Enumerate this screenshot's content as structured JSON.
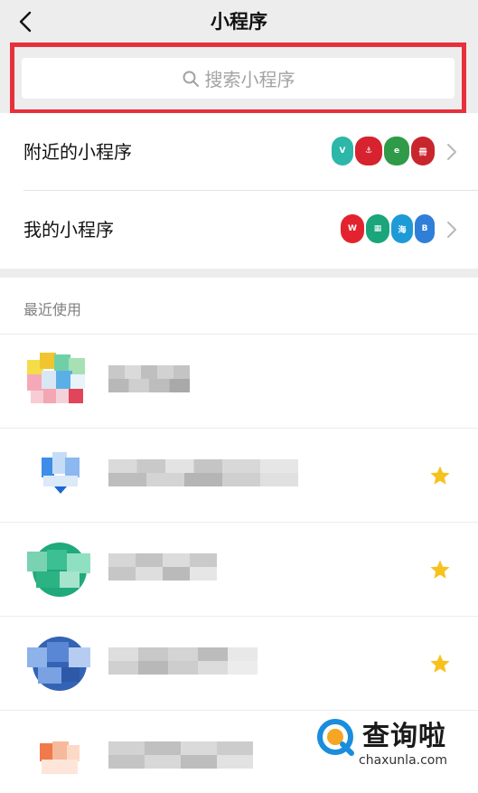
{
  "header": {
    "title": "小程序",
    "back_icon": "chevron-left-icon"
  },
  "search": {
    "placeholder": "搜索小程序",
    "icon": "search-icon",
    "highlight_color": "#e8303c"
  },
  "menu": {
    "nearby": {
      "label": "附近的小程序"
    },
    "mine": {
      "label": "我的小程序"
    }
  },
  "recent": {
    "section_label": "最近使用",
    "items": [
      {
        "starred": false
      },
      {
        "starred": true
      },
      {
        "starred": true
      },
      {
        "starred": true
      },
      {
        "starred": false
      }
    ]
  },
  "watermark": {
    "text": "查询啦",
    "url": "chaxunla.com"
  },
  "colors": {
    "star": "#f7c21e",
    "accent_blue": "#1a8ddc"
  }
}
